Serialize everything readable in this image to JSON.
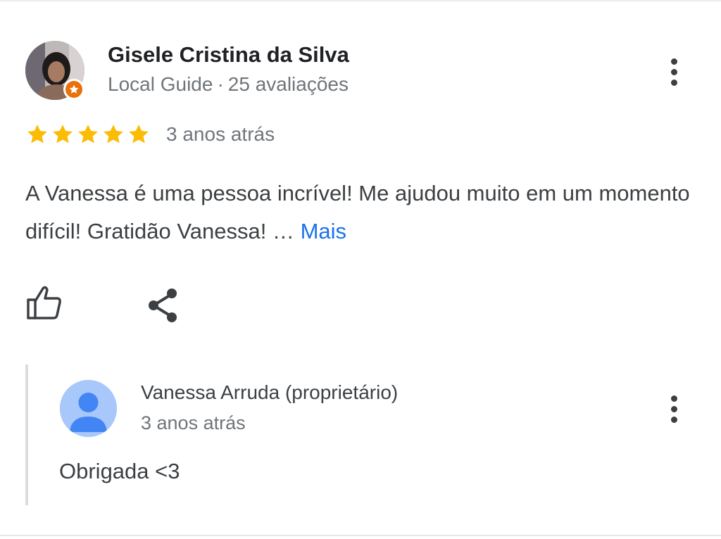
{
  "review": {
    "author_name": "Gisele Cristina da Silva",
    "author_badge": "Local Guide",
    "meta_separator": "·",
    "review_count": "25 avaliações",
    "rating": 5,
    "rating_max": 5,
    "date": "3 anos atrás",
    "text": "A Vanessa é uma pessoa incrível! Me ajudou muito em um momento difícil! Gratidão Vanessa! …",
    "more_label": "Mais"
  },
  "owner_reply": {
    "author_name": "Vanessa Arruda (proprietário)",
    "date": "3 anos atrás",
    "text": "Obrigada <3"
  },
  "icons": {
    "menu": "more-vert-icon",
    "like": "thumb-up-outline-icon",
    "share": "share-icon",
    "guide_badge": "local-guide-star-icon",
    "owner_avatar": "default-person-icon"
  },
  "colors": {
    "star": "#FBBC04",
    "link": "#1A73E8",
    "guide_badge": "#E8710A",
    "owner_avatar_bg": "#A8C7FA",
    "owner_avatar_fg": "#4285F4"
  }
}
